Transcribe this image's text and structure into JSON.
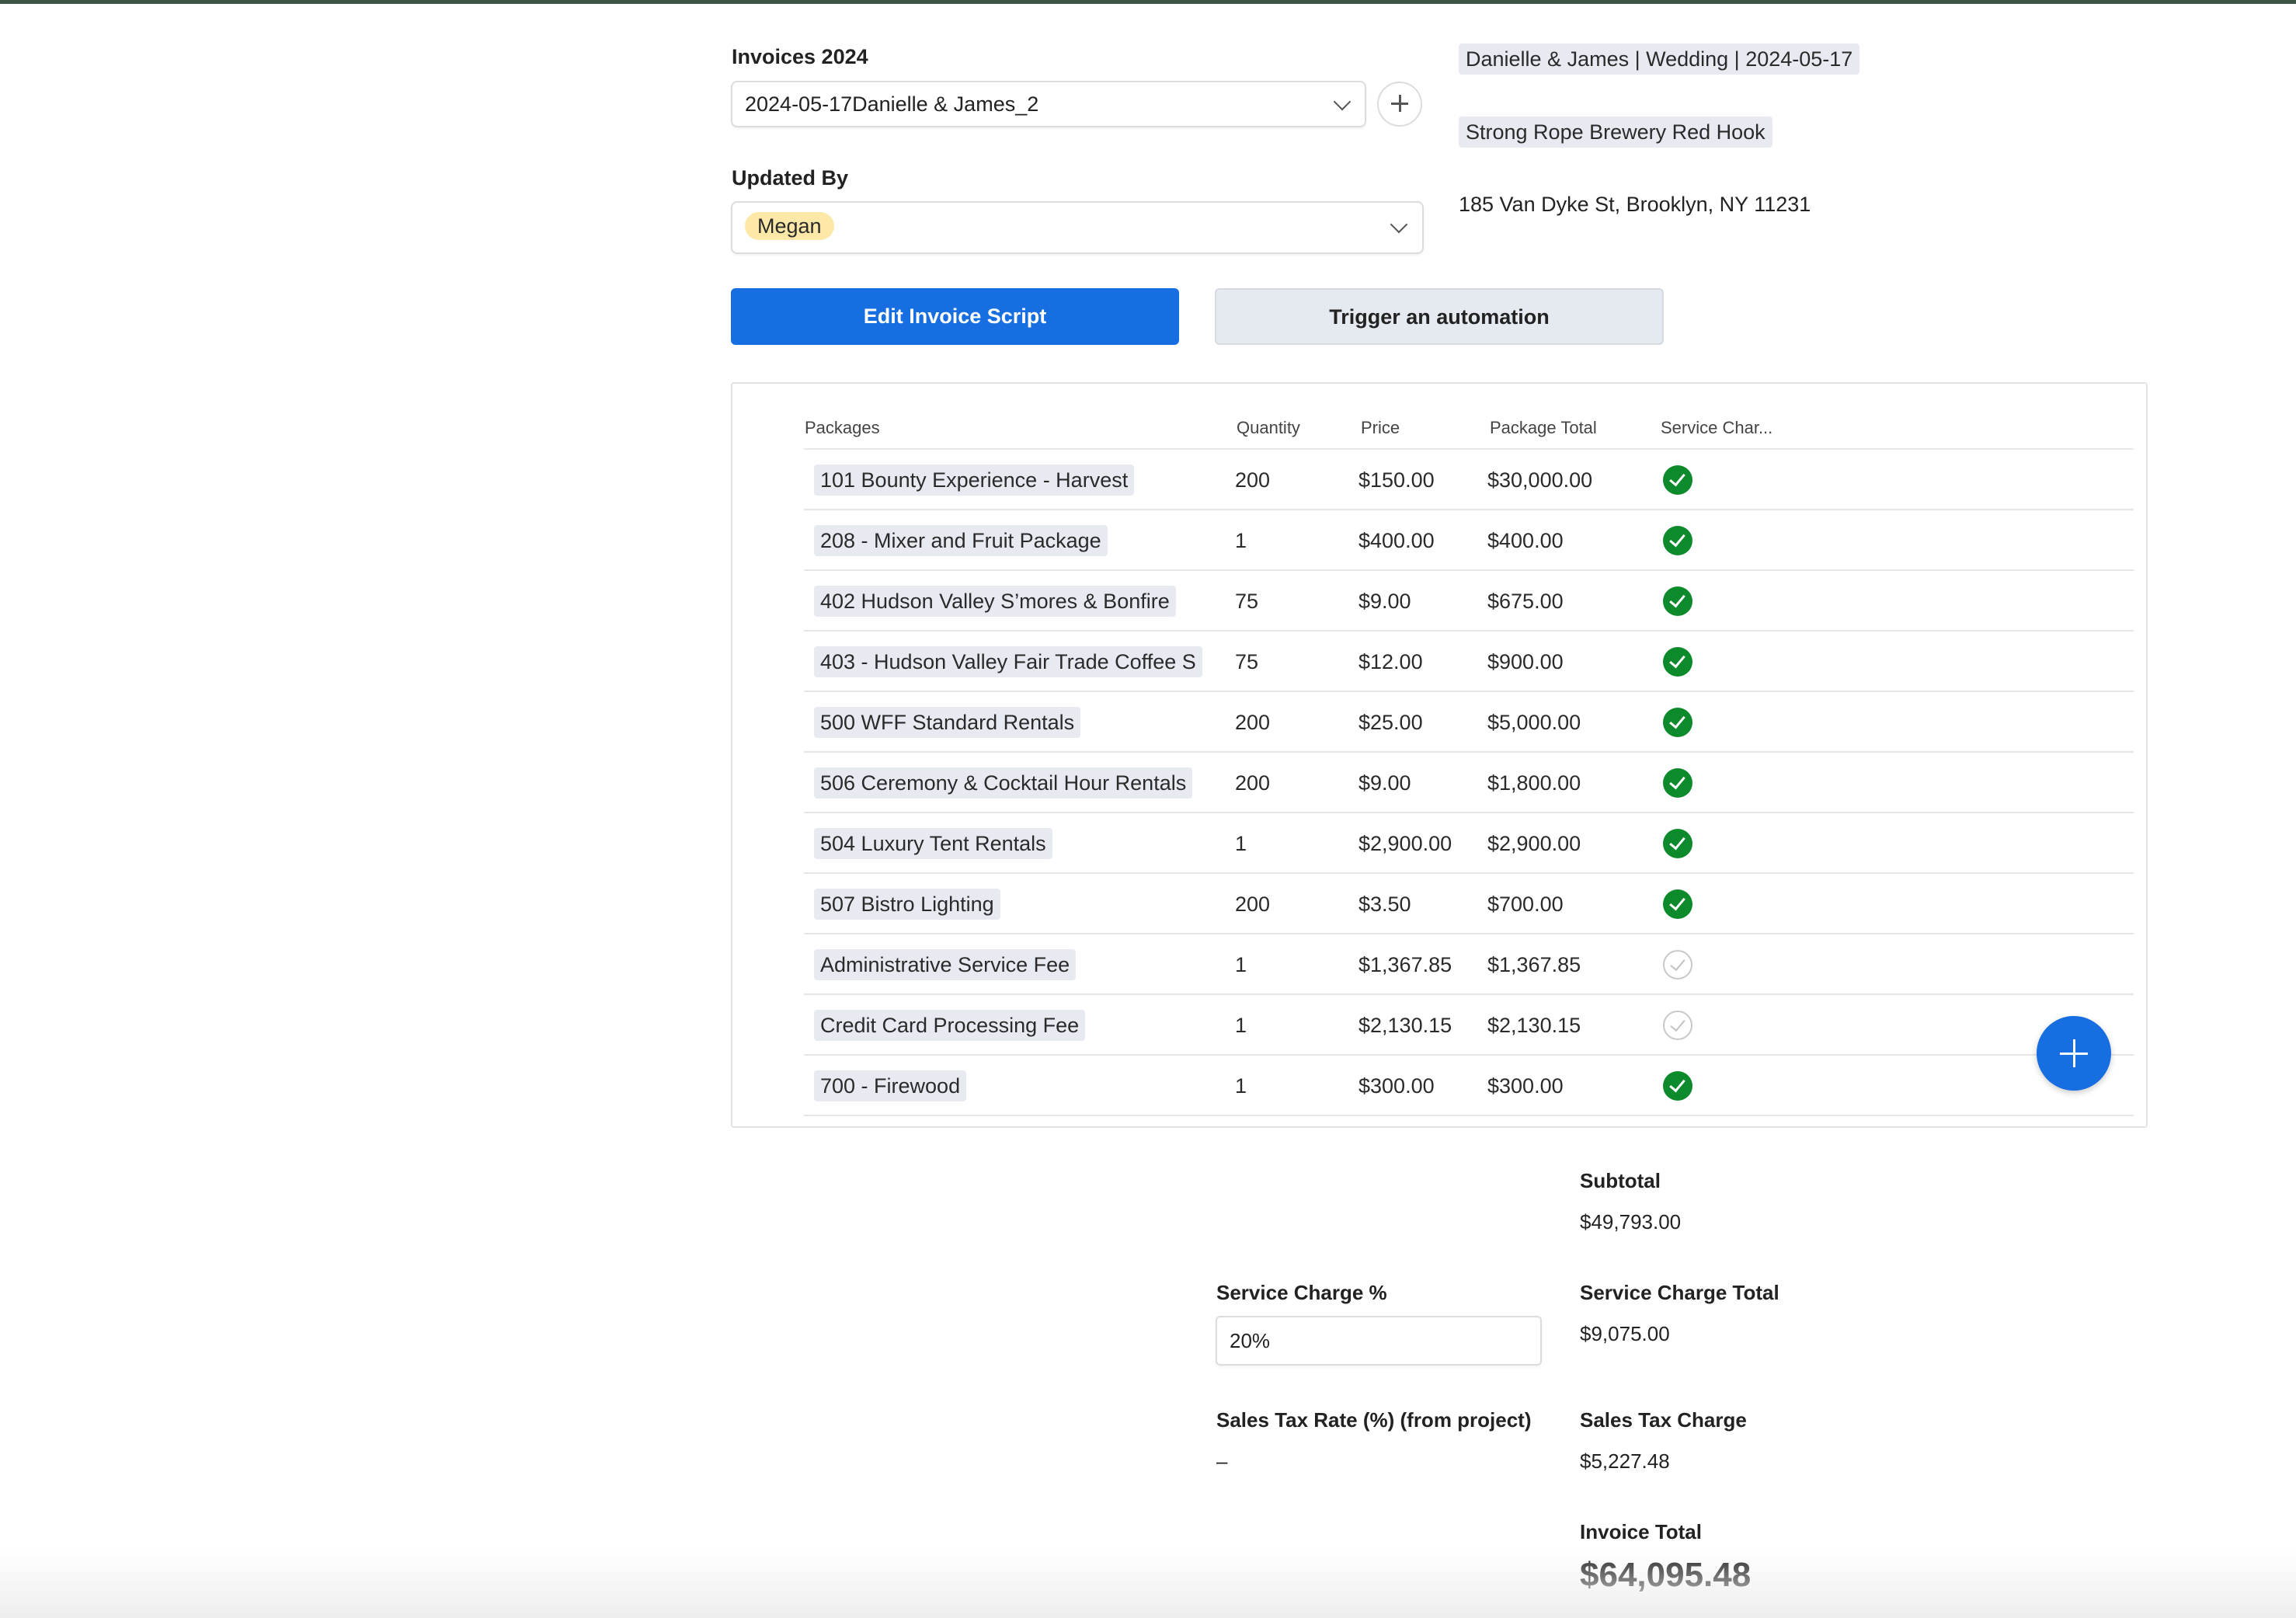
{
  "invoice_select": {
    "label": "Invoices 2024",
    "value": "2024-05-17Danielle & James_2"
  },
  "updated_by": {
    "label": "Updated By",
    "user": "Megan"
  },
  "project": {
    "name": "Danielle & James | Wedding | 2024-05-17",
    "venue": "Strong Rope Brewery Red Hook",
    "address": "185 Van Dyke St, Brooklyn, NY 11231"
  },
  "actions": {
    "edit_script": "Edit Invoice Script",
    "trigger": "Trigger an automation"
  },
  "table": {
    "headers": {
      "packages": "Packages",
      "quantity": "Quantity",
      "price": "Price",
      "total": "Package Total",
      "service": "Service Char..."
    },
    "rows": [
      {
        "package": "101 Bounty Experience - Harvest",
        "quantity": "200",
        "price": "$150.00",
        "total": "$30,000.00",
        "service": true
      },
      {
        "package": "208 - Mixer and Fruit Package",
        "quantity": "1",
        "price": "$400.00",
        "total": "$400.00",
        "service": true
      },
      {
        "package": "402 Hudson Valley S’mores & Bonfire",
        "quantity": "75",
        "price": "$9.00",
        "total": "$675.00",
        "service": true
      },
      {
        "package": "403 - Hudson Valley Fair Trade Coffee S",
        "quantity": "75",
        "price": "$12.00",
        "total": "$900.00",
        "service": true
      },
      {
        "package": "500 WFF Standard Rentals",
        "quantity": "200",
        "price": "$25.00",
        "total": "$5,000.00",
        "service": true
      },
      {
        "package": "506 Ceremony & Cocktail Hour Rentals",
        "quantity": "200",
        "price": "$9.00",
        "total": "$1,800.00",
        "service": true
      },
      {
        "package": "504 Luxury Tent Rentals",
        "quantity": "1",
        "price": "$2,900.00",
        "total": "$2,900.00",
        "service": true
      },
      {
        "package": "507 Bistro Lighting",
        "quantity": "200",
        "price": "$3.50",
        "total": "$700.00",
        "service": true
      },
      {
        "package": "Administrative Service Fee",
        "quantity": "1",
        "price": "$1,367.85",
        "total": "$1,367.85",
        "service": false
      },
      {
        "package": "Credit Card Processing Fee",
        "quantity": "1",
        "price": "$2,130.15",
        "total": "$2,130.15",
        "service": false
      },
      {
        "package": "700 - Firewood",
        "quantity": "1",
        "price": "$300.00",
        "total": "$300.00",
        "service": true
      }
    ]
  },
  "summary": {
    "subtotal_label": "Subtotal",
    "subtotal": "$49,793.00",
    "service_pct_label": "Service Charge %",
    "service_pct": "20%",
    "service_total_label": "Service Charge Total",
    "service_total": "$9,075.00",
    "tax_rate_label": "Sales Tax Rate (%) (from project)",
    "tax_rate": "–",
    "tax_charge_label": "Sales Tax Charge",
    "tax_charge": "$5,227.48",
    "invoice_total_label": "Invoice Total",
    "invoice_total": "$64,095.48"
  },
  "colors": {
    "primary": "#166ee1",
    "check_on": "#0d8a2b",
    "chip_bg": "#e8eaf2",
    "user_tag": "#fde8a8",
    "top_bar": "#3c5542"
  }
}
